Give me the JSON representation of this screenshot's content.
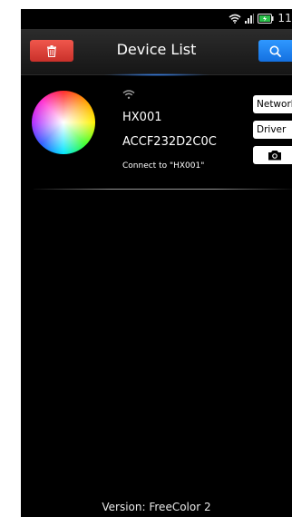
{
  "status_bar": {
    "time": "11",
    "icons": [
      "wifi-icon",
      "signal-icon",
      "battery-charging-icon"
    ]
  },
  "app_bar": {
    "title": "Device List",
    "left_icon": "trash-icon",
    "right_icon": "search-icon",
    "accent_color": "#1f7fff",
    "delete_color": "#e0443a"
  },
  "device": {
    "name": "HX001",
    "mac": "ACCF232D2C0C",
    "status": "Connect to \"HX001\"",
    "icon": "color-wheel-icon",
    "wifi_icon": "wifi-icon"
  },
  "actions": {
    "network_label": "Network",
    "driver_label": "Driver",
    "camera_icon": "camera-icon"
  },
  "footer": {
    "version": "Version: FreeColor 2"
  }
}
